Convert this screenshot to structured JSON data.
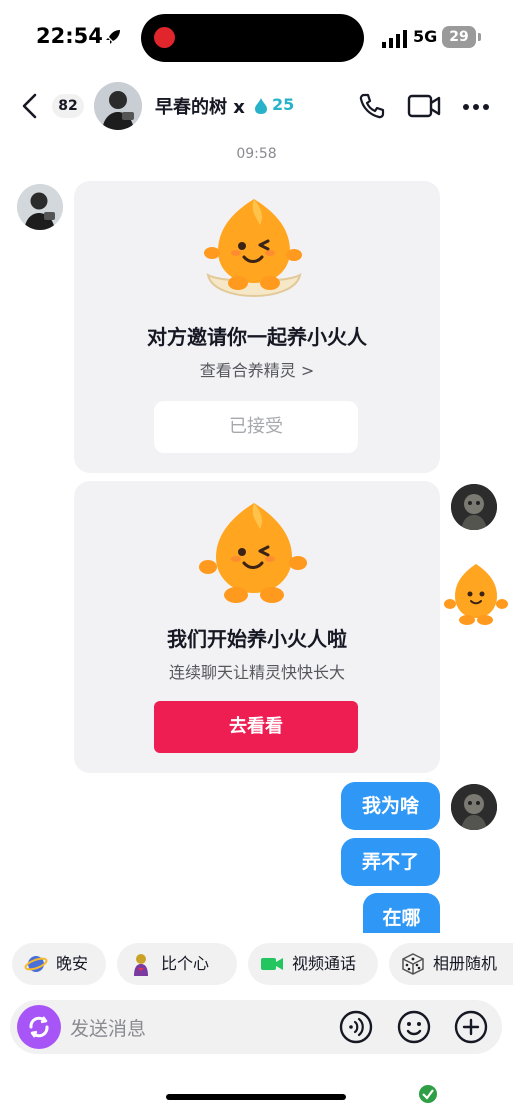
{
  "status_bar": {
    "time": "22:54",
    "network": "5G",
    "battery": "29"
  },
  "header": {
    "unread_count": "82",
    "contact_name": "早春的树 x",
    "spark_count": "25"
  },
  "timestamp": "09:58",
  "cards": [
    {
      "title": "对方邀请你一起养小火人",
      "subtitle": "查看合养精灵 >",
      "button": "已接受"
    },
    {
      "title": "我们开始养小火人啦",
      "subtitle": "连续聊天让精灵快快长大",
      "button": "去看看"
    }
  ],
  "messages": [
    "我为啥",
    "弄不了",
    "在哪"
  ],
  "quick_replies": [
    {
      "label": "晚安",
      "icon": "moon-planet-icon"
    },
    {
      "label": "比个心",
      "icon": "heart-gesture-icon"
    },
    {
      "label": "视频通话",
      "icon": "video-camera-icon"
    },
    {
      "label": "相册随机",
      "icon": "dice-icon"
    }
  ],
  "input": {
    "placeholder": "发送消息"
  },
  "colors": {
    "accent_red": "#ee1d52",
    "bubble_blue": "#2f97f5",
    "spark_teal": "#28b2c9"
  }
}
